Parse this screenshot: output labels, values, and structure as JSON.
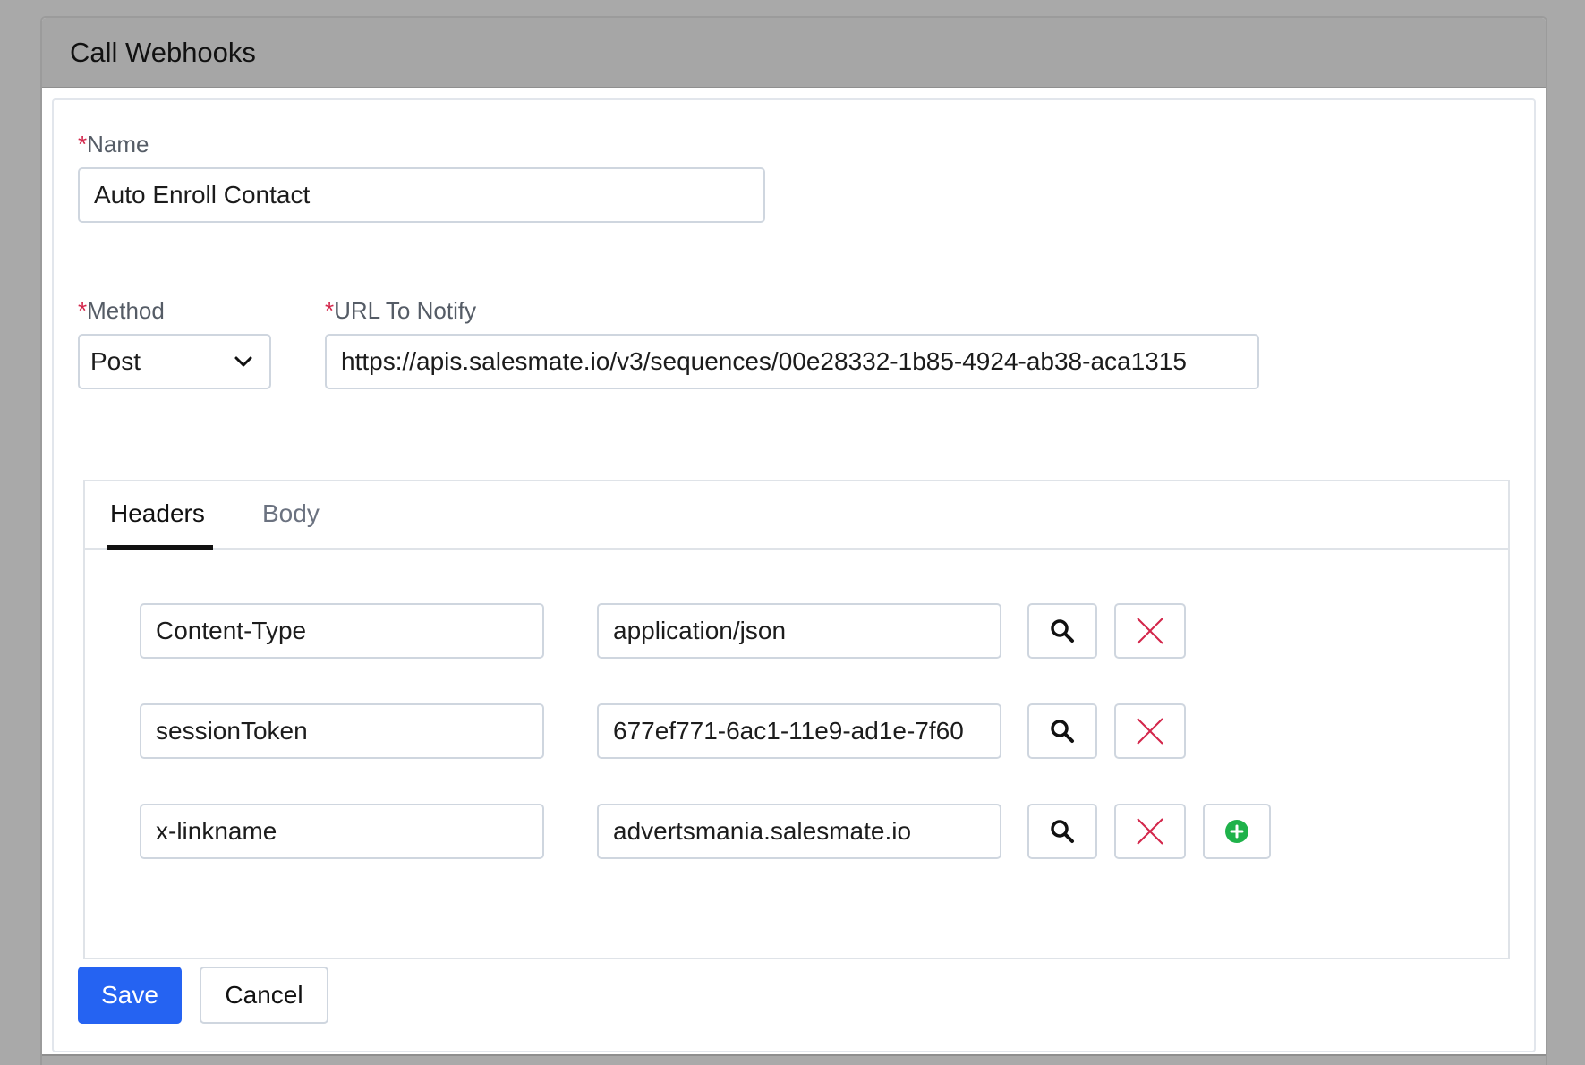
{
  "dialog": {
    "title": "Call Webhooks"
  },
  "form": {
    "name": {
      "required_mark": "*",
      "label": "Name",
      "value": "Auto Enroll Contact"
    },
    "method": {
      "required_mark": "*",
      "label": "Method",
      "value": "Post"
    },
    "url": {
      "required_mark": "*",
      "label": "URL To Notify",
      "value": "https://apis.salesmate.io/v3/sequences/00e28332-1b85-4924-ab38-aca1315"
    }
  },
  "tabs": [
    {
      "label": "Headers",
      "active": true
    },
    {
      "label": "Body",
      "active": false
    }
  ],
  "headers": [
    {
      "key": "Content-Type",
      "value": "application/json"
    },
    {
      "key": "sessionToken",
      "value": "677ef771-6ac1-11e9-ad1e-7f60"
    },
    {
      "key": "x-linkname",
      "value": "advertsmania.salesmate.io"
    }
  ],
  "actions": {
    "save_label": "Save",
    "cancel_label": "Cancel"
  },
  "colors": {
    "required": "#d3254a",
    "primary": "#2563f2",
    "remove_icon": "#d3254a",
    "add_icon": "#1fb24a"
  },
  "icons": {
    "search": "search-icon",
    "remove": "close-icon",
    "add": "plus-circle-icon",
    "dropdown": "chevron-down-icon"
  }
}
